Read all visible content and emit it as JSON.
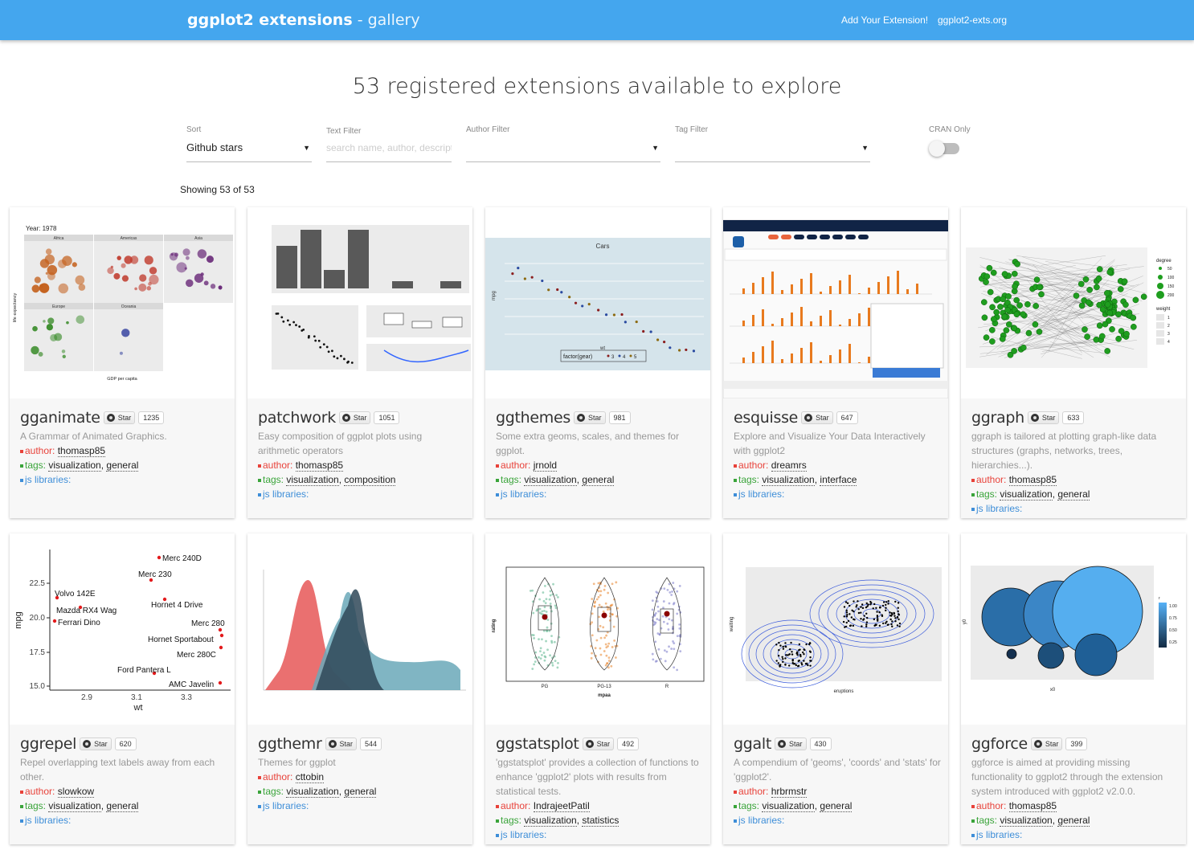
{
  "header": {
    "brand_bold": "ggplot2 extensions",
    "brand_sub": "- gallery",
    "links": [
      "Add Your Extension!",
      "ggplot2-exts.org"
    ],
    "bg_color": "#44a6ee"
  },
  "headline": "53 registered extensions available to explore",
  "filters": {
    "sort_label": "Sort",
    "sort_value": "Github stars",
    "text_label": "Text Filter",
    "text_placeholder": "search name, author, descript",
    "author_label": "Author Filter",
    "author_value": "",
    "tag_label": "Tag Filter",
    "tag_value": "",
    "cran_label": "CRAN Only",
    "cran_on": false
  },
  "showing": "Showing 53 of 53",
  "star_label": "Star",
  "labels": {
    "author": "author:",
    "tags": "tags:",
    "js": "js libraries:"
  },
  "cards": [
    {
      "name": "gganimate",
      "stars": "1235",
      "desc": "A Grammar of Animated Graphics.",
      "author": "thomasp85",
      "tags": [
        "visualization",
        "general"
      ]
    },
    {
      "name": "patchwork",
      "stars": "1051",
      "desc": "Easy composition of ggplot plots using arithmetic operators",
      "author": "thomasp85",
      "tags": [
        "visualization",
        "composition"
      ]
    },
    {
      "name": "ggthemes",
      "stars": "981",
      "desc": "Some extra geoms, scales, and themes for ggplot.",
      "author": "jrnold",
      "tags": [
        "visualization",
        "general"
      ]
    },
    {
      "name": "esquisse",
      "stars": "647",
      "desc": "Explore and Visualize Your Data Interactively with ggplot2",
      "author": "dreamrs",
      "tags": [
        "visualization",
        "interface"
      ]
    },
    {
      "name": "ggraph",
      "stars": "633",
      "desc": "ggraph is tailored at plotting graph-like data structures (graphs, networks, trees, hierarchies...).",
      "author": "thomasp85",
      "tags": [
        "visualization",
        "general"
      ]
    },
    {
      "name": "ggrepel",
      "stars": "620",
      "desc": "Repel overlapping text labels away from each other.",
      "author": "slowkow",
      "tags": [
        "visualization",
        "general"
      ]
    },
    {
      "name": "ggthemr",
      "stars": "544",
      "desc": "Themes for ggplot",
      "author": "cttobin",
      "tags": [
        "visualization",
        "general"
      ]
    },
    {
      "name": "ggstatsplot",
      "stars": "492",
      "desc": "'ggstatsplot' provides a collection of functions to enhance 'ggplot2' plots with results from statistical tests.",
      "author": "IndrajeetPatil",
      "tags": [
        "visualization",
        "statistics"
      ]
    },
    {
      "name": "ggalt",
      "stars": "430",
      "desc": "A compendium of 'geoms', 'coords' and 'stats' for 'ggplot2'.",
      "author": "hrbrmstr",
      "tags": [
        "visualization",
        "general"
      ]
    },
    {
      "name": "ggforce",
      "stars": "399",
      "desc": "ggforce is aimed at providing missing functionality to ggplot2 through the extension system introduced with ggplot2 v2.0.0.",
      "author": "thomasp85",
      "tags": [
        "visualization",
        "general"
      ]
    }
  ],
  "thumbs": {
    "gganimate": {
      "year_label": "Year: 1978",
      "panels": [
        "Africa",
        "Americas",
        "Asia",
        "Europe",
        "Oceania"
      ],
      "xlabel": "GDP per capita",
      "ylabel": "life expectancy"
    },
    "ggthemes": {
      "title": "Cars",
      "xlabel": "wt",
      "ylabel": "mpg",
      "legend": "factor(gear)",
      "levels": [
        "3",
        "4",
        "5"
      ]
    },
    "ggrepel": {
      "ylabel": "mpg",
      "xlabel": "wt",
      "yticks": [
        "22.5",
        "20.0",
        "17.5",
        "15.0"
      ],
      "xticks": [
        "2.9",
        "3.1",
        "3.3"
      ],
      "points": [
        "Merc 240D",
        "Merc 230",
        "Volvo 142E",
        "Hornet 4 Drive",
        "Mazda RX4 Wag",
        "Ferrari Dino",
        "Merc 280",
        "Hornet Sportabout",
        "Merc 280C",
        "Ford Pantera L",
        "AMC Javelin"
      ]
    },
    "ggstatsplot": {
      "xlabel": "mpaa",
      "ylabel": "rating",
      "groups": [
        "PG",
        "PG-13",
        "R"
      ]
    },
    "ggalt": {
      "xlabel": "eruptions",
      "ylabel": "waiting"
    },
    "ggforce": {
      "xlabel": "x0",
      "ylabel": "y0",
      "legend_title": "r",
      "legend_values": [
        "1.00",
        "0.75",
        "0.50",
        "0.25"
      ]
    },
    "ggraph": {
      "legend_degree": "degree",
      "degree_values": [
        "50",
        "100",
        "150",
        "200"
      ],
      "legend_weight": "weight",
      "weight_values": [
        "1",
        "2",
        "3",
        "4"
      ]
    }
  }
}
